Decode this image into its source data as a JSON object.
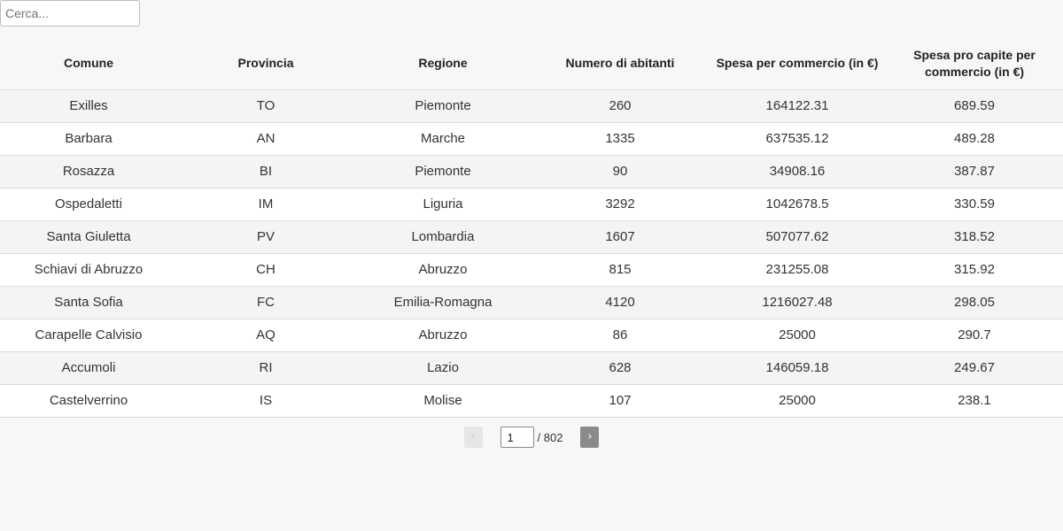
{
  "search": {
    "placeholder": "Cerca...",
    "value": ""
  },
  "table": {
    "headers": [
      "Comune",
      "Provincia",
      "Regione",
      "Numero di abitanti",
      "Spesa per commercio (in €)",
      "Spesa pro capite per commercio (in €)"
    ],
    "rows": [
      [
        "Exilles",
        "TO",
        "Piemonte",
        "260",
        "164122.31",
        "689.59"
      ],
      [
        "Barbara",
        "AN",
        "Marche",
        "1335",
        "637535.12",
        "489.28"
      ],
      [
        "Rosazza",
        "BI",
        "Piemonte",
        "90",
        "34908.16",
        "387.87"
      ],
      [
        "Ospedaletti",
        "IM",
        "Liguria",
        "3292",
        "1042678.5",
        "330.59"
      ],
      [
        "Santa Giuletta",
        "PV",
        "Lombardia",
        "1607",
        "507077.62",
        "318.52"
      ],
      [
        "Schiavi di Abruzzo",
        "CH",
        "Abruzzo",
        "815",
        "231255.08",
        "315.92"
      ],
      [
        "Santa Sofia",
        "FC",
        "Emilia-Romagna",
        "4120",
        "1216027.48",
        "298.05"
      ],
      [
        "Carapelle Calvisio",
        "AQ",
        "Abruzzo",
        "86",
        "25000",
        "290.7"
      ],
      [
        "Accumoli",
        "RI",
        "Lazio",
        "628",
        "146059.18",
        "249.67"
      ],
      [
        "Castelverrino",
        "IS",
        "Molise",
        "107",
        "25000",
        "238.1"
      ]
    ]
  },
  "pagination": {
    "prev_label": "‹",
    "next_label": "›",
    "current_page": "1",
    "total_label": "/ 802"
  }
}
